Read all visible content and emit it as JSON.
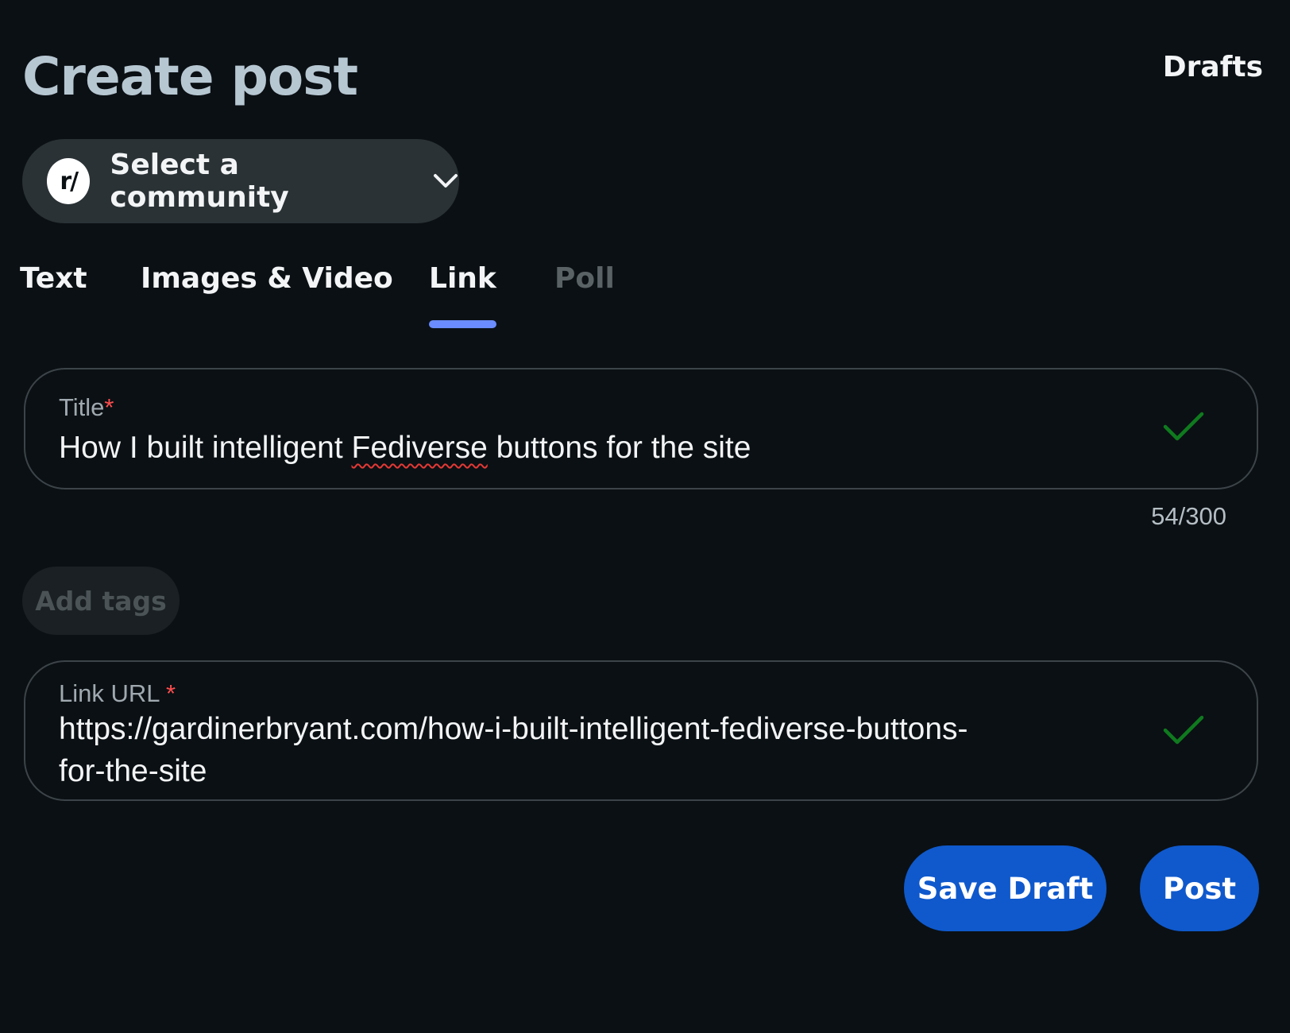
{
  "header": {
    "title": "Create post",
    "drafts_label": "Drafts"
  },
  "community": {
    "icon_text": "r/",
    "label": "Select a community"
  },
  "tabs": [
    {
      "label": "Text",
      "state": "enabled"
    },
    {
      "label": "Images & Video",
      "state": "enabled"
    },
    {
      "label": "Link",
      "state": "active"
    },
    {
      "label": "Poll",
      "state": "disabled"
    }
  ],
  "title_field": {
    "label": "Title",
    "required_marker": "*",
    "value_before": "How I built intelligent ",
    "value_misspelled": "Fediverse",
    "value_after": " buttons for the site",
    "counter": "54/300",
    "status_icon": "checkmark-icon"
  },
  "tags": {
    "label": "Add tags"
  },
  "link_field": {
    "label": "Link URL ",
    "required_marker": "*",
    "value_line1": "https://gardinerbryant.com/how-i-built-intelligent-fediverse-buttons-",
    "value_line2": "for-the-site",
    "status_icon": "checkmark-icon"
  },
  "actions": {
    "save_draft_label": "Save Draft",
    "post_label": "Post"
  },
  "colors": {
    "background": "#0b1014",
    "accent": "#6a8cff",
    "primary_button": "#0f59cc",
    "valid_check": "#0f7a1e",
    "required": "#ff4d4d"
  }
}
